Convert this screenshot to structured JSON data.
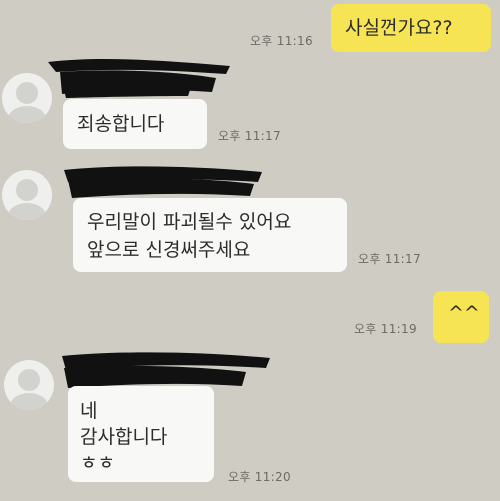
{
  "colors": {
    "background": "#cfccc4",
    "outgoing_bubble": "#f7e454",
    "incoming_bubble": "#f8f8f6",
    "redaction": "#111111"
  },
  "messages": [
    {
      "direction": "outgoing",
      "lines": [
        "사실껀가요??"
      ],
      "time": "오후 11:16"
    },
    {
      "direction": "incoming",
      "sender_name_redacted": true,
      "avatar_icon": "default-profile-icon",
      "lines": [
        "죄송합니다"
      ],
      "time": "오후 11:17"
    },
    {
      "direction": "incoming",
      "sender_name_redacted": true,
      "avatar_icon": "default-profile-icon",
      "lines": [
        "우리말이 파괴될수 있어요",
        "앞으로  신경써주세요"
      ],
      "time": "오후 11:17"
    },
    {
      "direction": "outgoing",
      "lines": [
        "^^"
      ],
      "time": "오후 11:19"
    },
    {
      "direction": "incoming",
      "sender_name_redacted": true,
      "avatar_icon": "default-profile-icon",
      "lines": [
        "네",
        "감사합니다",
        "ㅎㅎ"
      ],
      "time": "오후 11:20"
    }
  ]
}
